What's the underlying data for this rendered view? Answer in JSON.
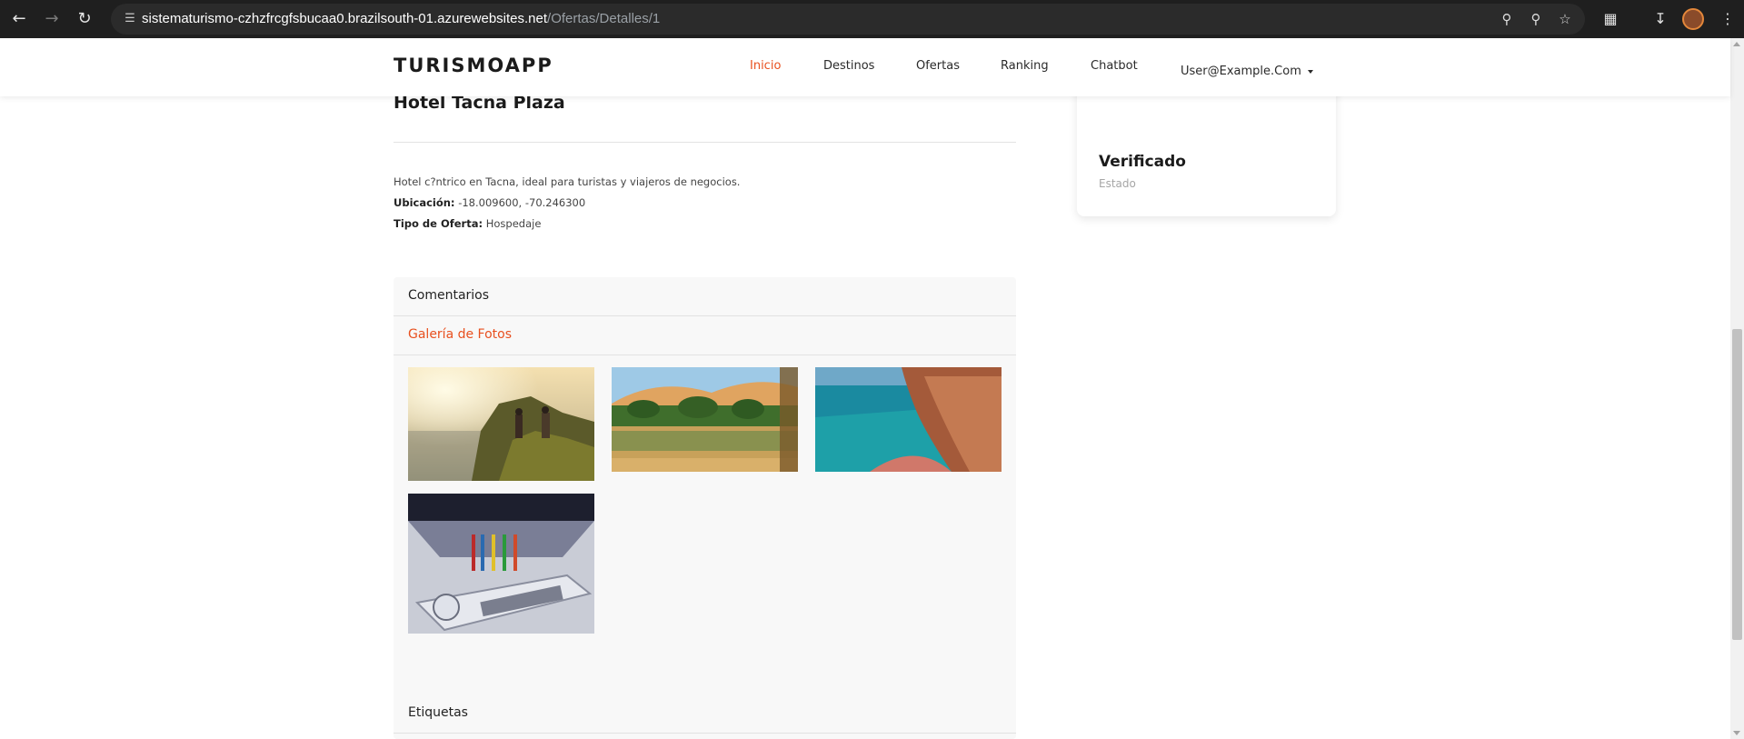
{
  "browser": {
    "url_host": "sistematurismo-czhzfrcgfsbucaa0.brazilsouth-01.azurewebsites.net",
    "url_path": "/Ofertas/Detalles/1",
    "icons": [
      "back-icon",
      "forward-icon",
      "reload-icon",
      "site-info-icon",
      "location-icon",
      "zoom-icon",
      "bookmark-star-icon",
      "extensions-icon",
      "download-icon",
      "profile-icon",
      "kebab-menu-icon"
    ]
  },
  "header": {
    "brand": "TURISMOAPP",
    "nav": [
      {
        "label": "Inicio",
        "active": true
      },
      {
        "label": "Destinos",
        "active": false
      },
      {
        "label": "Ofertas",
        "active": false
      },
      {
        "label": "Ranking",
        "active": false
      },
      {
        "label": "Chatbot",
        "active": false
      }
    ],
    "user": "User@Example.Com"
  },
  "offer": {
    "title": "Hotel Tacna Plaza",
    "description": "Hotel c?ntrico en Tacna, ideal para turistas y viajeros de negocios.",
    "location_label": "Ubicación:",
    "location_value": "-18.009600, -70.246300",
    "type_label": "Tipo de Oferta:",
    "type_value": "Hospedaje"
  },
  "status_card": {
    "value": "Verificado",
    "label": "Estado"
  },
  "sections": {
    "comments": "Comentarios",
    "gallery": "Galería de Fotos",
    "tags": "Etiquetas"
  },
  "gallery": [
    {
      "name": "photo-hikers-cliff"
    },
    {
      "name": "photo-desert-oasis"
    },
    {
      "name": "photo-coastal-cliffs"
    },
    {
      "name": "photo-hotel-plaza-sign"
    }
  ],
  "colors": {
    "accent": "#e8501f",
    "chrome_bg": "#1f1f1f",
    "panel_bg": "#f8f8f8"
  }
}
